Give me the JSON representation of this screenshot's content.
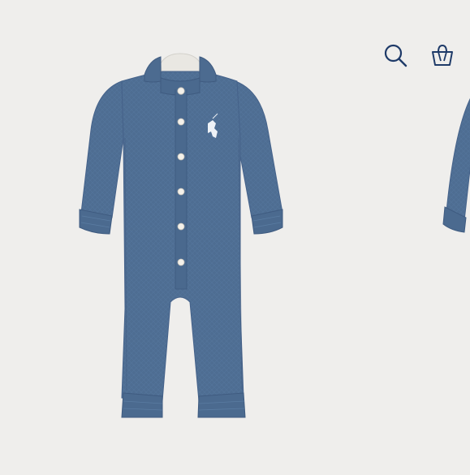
{
  "header": {
    "icons": [
      {
        "name": "search-icon"
      },
      {
        "name": "shopping-bag-icon"
      }
    ]
  },
  "product": {
    "color": "#4f6f94",
    "button_color": "#f4f1ea",
    "logo_color": "#eef2f7"
  }
}
